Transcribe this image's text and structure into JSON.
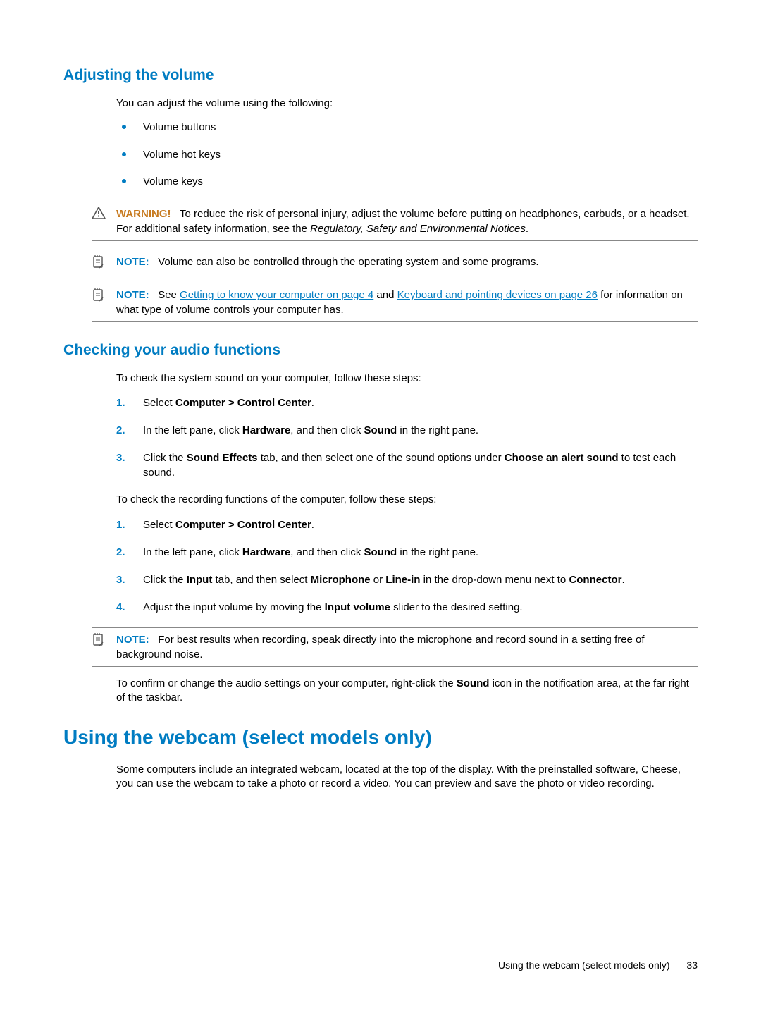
{
  "section1": {
    "heading": "Adjusting the volume",
    "intro": "You can adjust the volume using the following:",
    "bullets": [
      "Volume buttons",
      "Volume hot keys",
      "Volume keys"
    ],
    "warning": {
      "label": "WARNING!",
      "body_pre": "To reduce the risk of personal injury, adjust the volume before putting on headphones, earbuds, or a headset. For additional safety information, see the ",
      "italic": "Regulatory, Safety and Environmental Notices",
      "body_post": "."
    },
    "note1": {
      "label": "NOTE:",
      "body": "Volume can also be controlled through the operating system and some programs."
    },
    "note2": {
      "label": "NOTE:",
      "pre": "See ",
      "link1": "Getting to know your computer on page 4",
      "mid": " and ",
      "link2": "Keyboard and pointing devices on page 26",
      "post": " for information on what type of volume controls your computer has."
    }
  },
  "section2": {
    "heading": "Checking your audio functions",
    "intro1": "To check the system sound on your computer, follow these steps:",
    "steps1": {
      "s1_pre": "Select ",
      "s1_b": "Computer > Control Center",
      "s1_post": ".",
      "s2_pre": "In the left pane, click ",
      "s2_b1": "Hardware",
      "s2_mid": ", and then click ",
      "s2_b2": "Sound",
      "s2_post": " in the right pane.",
      "s3_pre": "Click the ",
      "s3_b1": "Sound Effects",
      "s3_mid": " tab, and then select one of the sound options under ",
      "s3_b2": "Choose an alert sound",
      "s3_post": " to test each sound."
    },
    "intro2": "To check the recording functions of the computer, follow these steps:",
    "steps2": {
      "s1_pre": "Select ",
      "s1_b": "Computer > Control Center",
      "s1_post": ".",
      "s2_pre": "In the left pane, click ",
      "s2_b1": "Hardware",
      "s2_mid": ", and then click ",
      "s2_b2": "Sound",
      "s2_post": " in the right pane.",
      "s3_pre": "Click the ",
      "s3_b1": "Input",
      "s3_mid1": " tab, and then select ",
      "s3_b2": "Microphone",
      "s3_mid2": " or ",
      "s3_b3": "Line-in",
      "s3_mid3": " in the drop-down menu next to ",
      "s3_b4": "Connector",
      "s3_post": ".",
      "s4_pre": "Adjust the input volume by moving the ",
      "s4_b": "Input volume",
      "s4_post": " slider to the desired setting."
    },
    "note3": {
      "label": "NOTE:",
      "body": "For best results when recording, speak directly into the microphone and record sound in a setting free of background noise."
    },
    "outro_pre": "To confirm or change the audio settings on your computer, right-click the ",
    "outro_b": "Sound",
    "outro_post": " icon in the notification area, at the far right of the taskbar."
  },
  "section3": {
    "heading": "Using the webcam (select models only)",
    "body": "Some computers include an integrated webcam, located at the top of the display. With the preinstalled software, Cheese, you can use the webcam to take a photo or record a video. You can preview and save the photo or video recording."
  },
  "footer": {
    "title": "Using the webcam (select models only)",
    "page": "33"
  }
}
